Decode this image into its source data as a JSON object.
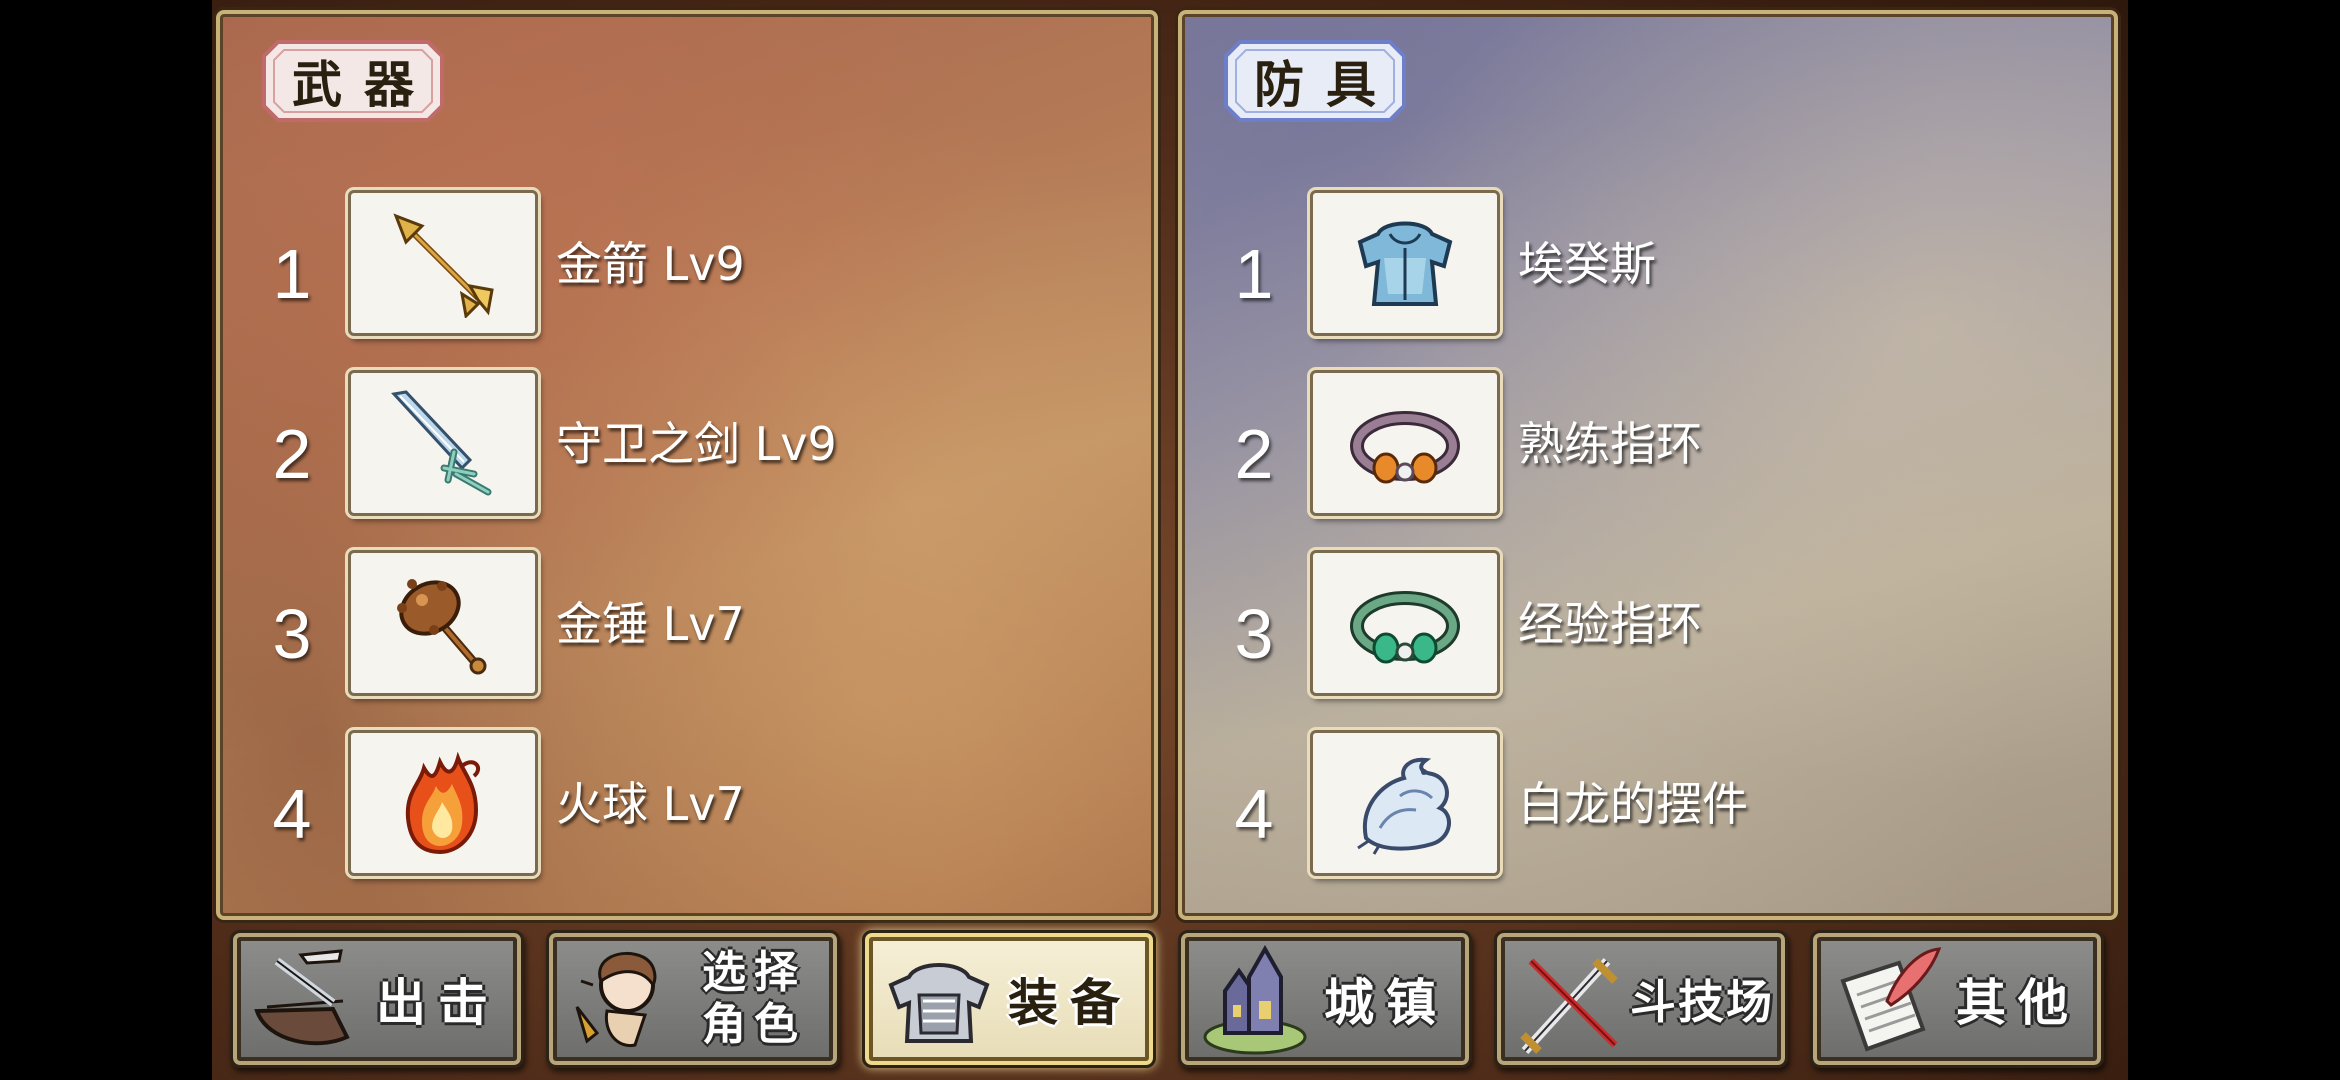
{
  "weapons": {
    "title": "武器",
    "items": [
      {
        "index": "1",
        "label": "金箭 Lv9",
        "icon": "golden-arrow-icon"
      },
      {
        "index": "2",
        "label": "守卫之剑 Lv9",
        "icon": "guard-sword-icon"
      },
      {
        "index": "3",
        "label": "金锤 Lv7",
        "icon": "golden-hammer-icon"
      },
      {
        "index": "4",
        "label": "火球 Lv7",
        "icon": "fireball-icon"
      }
    ]
  },
  "armor": {
    "title": "防具",
    "items": [
      {
        "index": "1",
        "label": "埃癸斯",
        "icon": "aegis-armor-icon"
      },
      {
        "index": "2",
        "label": "熟练指环",
        "icon": "skill-ring-icon"
      },
      {
        "index": "3",
        "label": "经验指环",
        "icon": "exp-ring-icon"
      },
      {
        "index": "4",
        "label": "白龙的摆件",
        "icon": "white-dragon-ornament-icon"
      }
    ]
  },
  "nav": {
    "sortie": "出击",
    "select_line1": "选择",
    "select_line2": "角色",
    "equipment": "装备",
    "town": "城镇",
    "arena": "斗技场",
    "other": "其他",
    "active": "equipment"
  },
  "colors": {
    "weapon_panel": "#b47a56",
    "armor_panel": "#9894a6",
    "weapon_tag_border": "#c06a6a",
    "armor_tag_border": "#6c7fc8",
    "active_button": "#f6f0d8"
  }
}
